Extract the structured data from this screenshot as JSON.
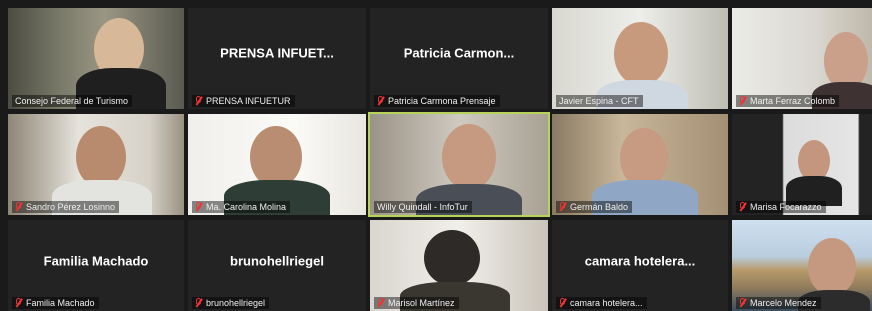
{
  "participants": [
    {
      "tile_name": "Consejo Federal de Turismo",
      "video": true
    },
    {
      "tile_name": "PRENSA INFUETUR",
      "display": "PRENSA INFUET...",
      "video": false
    },
    {
      "tile_name": "Patricia Carmona Prensaje",
      "display": "Patricia Carmon...",
      "video": false
    },
    {
      "tile_name": "Javier Espina - CFT",
      "video": true
    },
    {
      "tile_name": "Marta Ferraz Colomb",
      "video": true
    },
    {
      "tile_name": "Sandro Pérez Losinno",
      "video": true
    },
    {
      "tile_name": "Ma. Carolina Molina",
      "video": true
    },
    {
      "tile_name": "Willy Quindall - InfoTur",
      "video": true,
      "speaking": true
    },
    {
      "tile_name": "Germán Baldo",
      "video": true
    },
    {
      "tile_name": "Marisa Focarazzo",
      "video": true
    },
    {
      "tile_name": "Familia Machado",
      "display": "Familia Machado",
      "video": false
    },
    {
      "tile_name": "brunohellriegel",
      "display": "brunohellriegel",
      "video": false
    },
    {
      "tile_name": "Marisol Martínez",
      "video": true
    },
    {
      "tile_name": "camara hotelera...",
      "display": "camara hotelera...",
      "video": false
    },
    {
      "tile_name": "Marcelo Mendez",
      "video": true
    }
  ],
  "colors": {
    "speaker_border": "#b7d35a",
    "mute_red": "#e33333",
    "tile_bg": "#232323"
  }
}
